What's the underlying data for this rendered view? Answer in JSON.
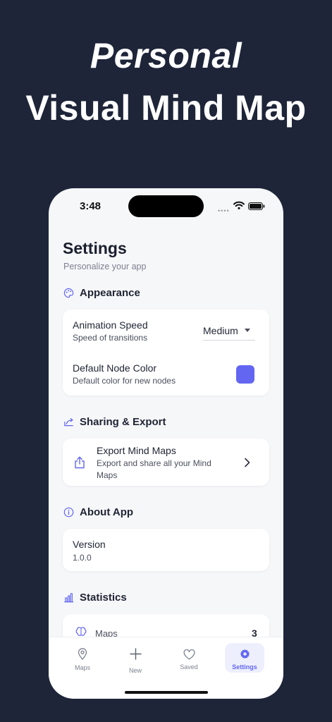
{
  "hero": {
    "line1": "Personal",
    "line2": "Visual Mind Map"
  },
  "status_bar": {
    "time": "3:48"
  },
  "header": {
    "title": "Settings",
    "subtitle": "Personalize your app"
  },
  "appearance": {
    "title": "Appearance",
    "animation_speed": {
      "label": "Animation Speed",
      "description": "Speed of transitions",
      "value": "Medium"
    },
    "node_color": {
      "label": "Default Node Color",
      "description": "Default color for new nodes",
      "color": "#6366f1"
    }
  },
  "sharing": {
    "title": "Sharing & Export",
    "export": {
      "label": "Export Mind Maps",
      "description_line1": "Export and share all your Mind",
      "description_line2": "Maps"
    }
  },
  "about": {
    "title": "About App",
    "version_label": "Version",
    "version_value": "1.0.0"
  },
  "statistics": {
    "title": "Statistics",
    "maps_label": "Maps",
    "maps_value": "3"
  },
  "tabbar": {
    "tabs": [
      {
        "label": "Maps",
        "icon": "map-pin-icon"
      },
      {
        "label": "New",
        "icon": "plus-icon"
      },
      {
        "label": "Saved",
        "icon": "heart-icon"
      },
      {
        "label": "Settings",
        "icon": "gear-icon",
        "active": true
      }
    ]
  },
  "colors": {
    "accent": "#6366f1",
    "background": "#1e2539"
  }
}
